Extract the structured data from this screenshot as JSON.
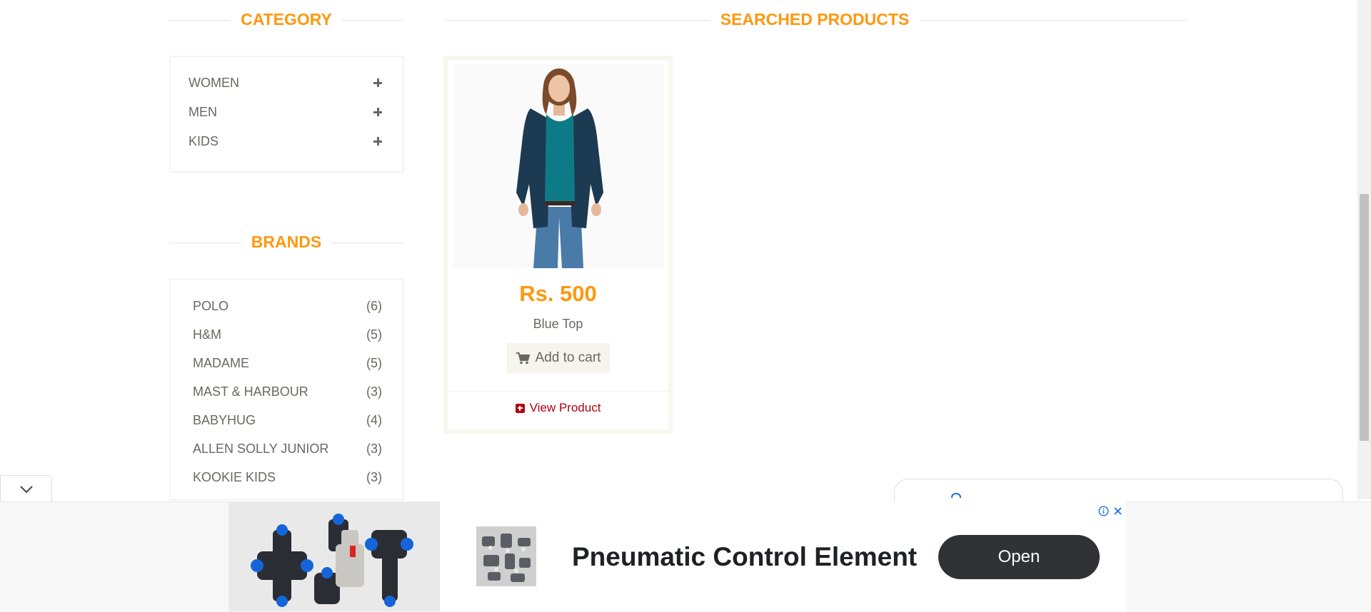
{
  "sidebar": {
    "category_heading": "CATEGORY",
    "categories": [
      {
        "label": "WOMEN"
      },
      {
        "label": "MEN"
      },
      {
        "label": "KIDS"
      }
    ],
    "brands_heading": "BRANDS",
    "brands": [
      {
        "label": "POLO",
        "count": "(6)"
      },
      {
        "label": "H&M",
        "count": "(5)"
      },
      {
        "label": "MADAME",
        "count": "(5)"
      },
      {
        "label": "MAST & HARBOUR",
        "count": "(3)"
      },
      {
        "label": "BABYHUG",
        "count": "(4)"
      },
      {
        "label": "ALLEN SOLLY JUNIOR",
        "count": "(3)"
      },
      {
        "label": "KOOKIE KIDS",
        "count": "(3)"
      }
    ]
  },
  "main": {
    "heading": "SEARCHED PRODUCTS",
    "products": [
      {
        "price": "Rs. 500",
        "name": "Blue Top",
        "add_to_cart": "Add to cart",
        "view_product": "View Product"
      }
    ]
  },
  "ad": {
    "title": "Pneumatic Control Element",
    "open_label": "Open"
  },
  "colors": {
    "accent": "#fe980f",
    "link": "#b3000f",
    "text": "#696763",
    "ad_button": "#303235"
  },
  "icons": [
    "plus-icon",
    "cart-icon",
    "square-plus-icon",
    "chevron-down-icon",
    "info-icon",
    "close-icon"
  ]
}
